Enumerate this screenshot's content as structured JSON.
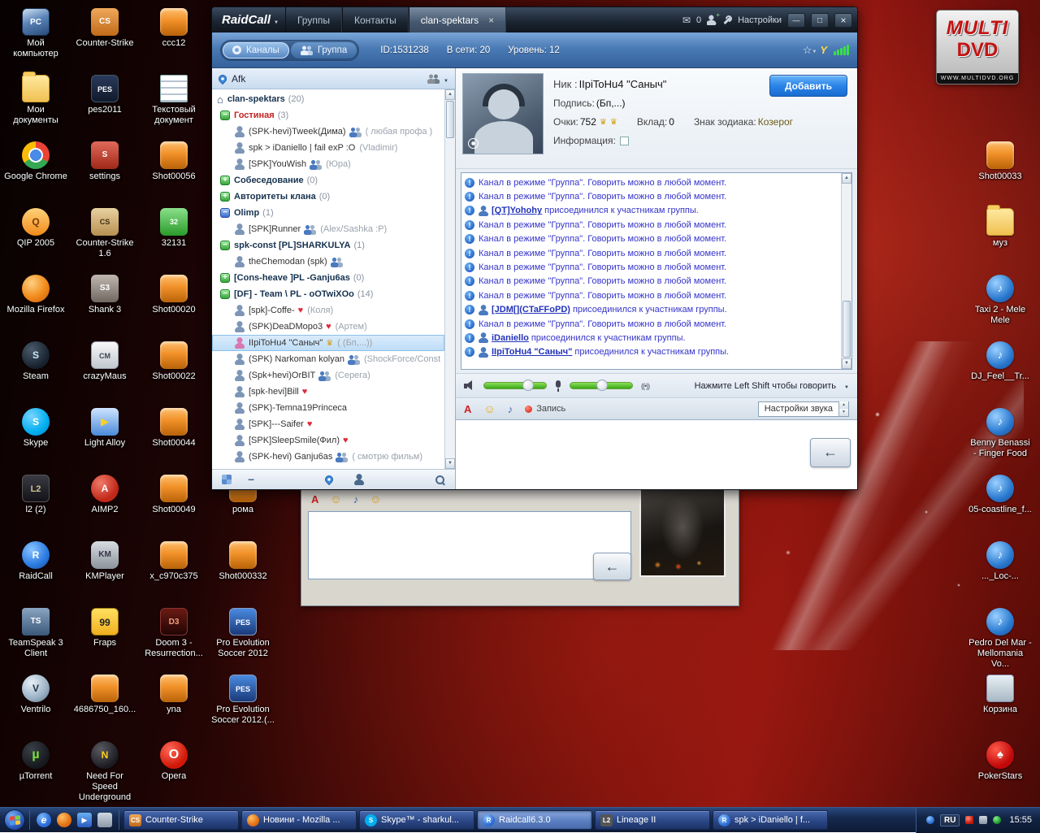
{
  "desktop": {
    "logo": {
      "line1": "MULTI",
      "line2": "DVD",
      "url": "WWW.MULTIDVD.ORG"
    },
    "left_columns": [
      [
        {
          "label": "Мой компьютер",
          "icon": "my-computer"
        },
        {
          "label": "Мои документы",
          "icon": "folder"
        },
        {
          "label": "Google Chrome",
          "icon": "chrome"
        },
        {
          "label": "QIP 2005",
          "icon": "qip"
        },
        {
          "label": "Mozilla Firefox",
          "icon": "firefox"
        },
        {
          "label": "Steam",
          "icon": "steam"
        },
        {
          "label": "Skype",
          "icon": "skype"
        },
        {
          "label": "l2 (2)",
          "icon": "lineage2"
        },
        {
          "label": "RaidCall",
          "icon": "raidcall"
        },
        {
          "label": "TeamSpeak 3 Client",
          "icon": "teamspeak"
        },
        {
          "label": "Ventrilo",
          "icon": "ventrilo"
        },
        {
          "label": "µTorrent",
          "icon": "utorrent"
        }
      ],
      [
        {
          "label": "Counter-Strike",
          "icon": "cs"
        },
        {
          "label": "pes2011",
          "icon": "pes"
        },
        {
          "label": "settings",
          "icon": "red-app"
        },
        {
          "label": "Counter-Strike 1.6",
          "icon": "cs16"
        },
        {
          "label": "Shank 3",
          "icon": "shank"
        },
        {
          "label": "crazyMaus",
          "icon": "crazymaus"
        },
        {
          "label": "Light Alloy",
          "icon": "lightalloy"
        },
        {
          "label": "AIMP2",
          "icon": "aimp"
        },
        {
          "label": "KMPlayer",
          "icon": "kmplayer"
        },
        {
          "label": "Fraps",
          "icon": "fraps"
        },
        {
          "label": "4686750_160...",
          "icon": "shot"
        },
        {
          "label": "Need For Speed Underground",
          "icon": "nfs"
        }
      ],
      [
        {
          "label": "ccc12",
          "icon": "shot"
        },
        {
          "label": "Текстовый документ",
          "icon": "textdoc"
        },
        {
          "label": "Shot00056",
          "icon": "shot"
        },
        {
          "label": "32131",
          "icon": "green"
        },
        {
          "label": "Shot00020",
          "icon": "shot"
        },
        {
          "label": "Shot00022",
          "icon": "shot"
        },
        {
          "label": "Shot00044",
          "icon": "shot"
        },
        {
          "label": "Shot00049",
          "icon": "shot"
        },
        {
          "label": "x_c970c375",
          "icon": "shot"
        },
        {
          "label": "Doom 3 - Resurrection...",
          "icon": "doom"
        },
        {
          "label": "yna",
          "icon": "shot"
        },
        {
          "label": "Opera",
          "icon": "opera"
        }
      ],
      [
        {
          "label": "рома",
          "icon": "shot",
          "row": 7
        },
        {
          "label": "Shot000332",
          "icon": "shot",
          "row": 8
        },
        {
          "label": "Pro Evolution Soccer 2012",
          "icon": "pes2012",
          "row": 9
        },
        {
          "label": "Pro Evolution Soccer 2012.(...",
          "icon": "pes2012",
          "row": 10
        }
      ]
    ],
    "right_column": [
      {
        "label": "Shot00033",
        "icon": "shot",
        "row": 2
      },
      {
        "label": "муз",
        "icon": "folder",
        "row": 3
      },
      {
        "label": "Taxi 2 - Mele Mele",
        "icon": "media",
        "row": 4
      },
      {
        "label": "DJ_Feel__Tr...",
        "icon": "media",
        "row": 5
      },
      {
        "label": "Benny Benassi - Finger Food",
        "icon": "media",
        "row": 6
      },
      {
        "label": "05-coastline_f...",
        "icon": "media",
        "row": 7
      },
      {
        "label": "..._Loc-...",
        "icon": "media",
        "row": 8
      },
      {
        "label": "Pedro Del Mar - Mellomania Vo...",
        "icon": "media",
        "row": 9
      },
      {
        "label": "Корзина",
        "icon": "recycle",
        "row": 10
      },
      {
        "label": "PokerStars",
        "icon": "pokerstars",
        "row": 11
      }
    ]
  },
  "raidcall": {
    "titlebar": {
      "app": "RaidCall",
      "mail_count": "0",
      "settings": "Настройки",
      "tabs": [
        {
          "label": "Группы"
        },
        {
          "label": "Контакты"
        },
        {
          "label": "clan-spektars",
          "active": true,
          "closable": true
        }
      ]
    },
    "infobar": {
      "channels": "Каналы",
      "group": "Группа",
      "id": "ID:1531238",
      "online": "В сети: 20",
      "level": "Уровень: 12"
    },
    "status": "Afk",
    "tree": [
      {
        "t": "home",
        "label": "clan-spektars",
        "count": "(20)"
      },
      {
        "t": "ch",
        "exp": true,
        "red": true,
        "label": "Гостиная",
        "count": "(3)"
      },
      {
        "t": "user",
        "label": "(SPK-hevi)Tweek(Дима)",
        "badges": [
          "group"
        ],
        "note": "( любая профа )"
      },
      {
        "t": "user",
        "label": "spk > iDaniello | fail exP :O",
        "note": "(Vladimir)"
      },
      {
        "t": "user",
        "label": "[SPK]YouWish",
        "badges": [
          "group"
        ],
        "note": "(Юра)"
      },
      {
        "t": "ch",
        "exp": false,
        "label": "Собеседование",
        "count": "(0)"
      },
      {
        "t": "ch",
        "exp": false,
        "label": "Авторитеты клана",
        "count": "(0)"
      },
      {
        "t": "ch",
        "exp": true,
        "blue": true,
        "label": "Olimp",
        "count": "(1)"
      },
      {
        "t": "user",
        "label": "[SPK]Runner",
        "badges": [
          "group"
        ],
        "note": "(Alex/Sashka :P)"
      },
      {
        "t": "ch",
        "exp": true,
        "label": "spk-const [PL]SHARKULYA",
        "count": "(1)"
      },
      {
        "t": "user",
        "label": "theChemodan (spk)",
        "badges": [
          "group"
        ]
      },
      {
        "t": "ch",
        "exp": false,
        "label": "[Cons-heave ]PL -Ganju6as",
        "count": "(0)"
      },
      {
        "t": "ch",
        "exp": true,
        "label": "[DF] - Team \\ PL - oOTwiXOo",
        "count": "(14)"
      },
      {
        "t": "user",
        "label": "[spk]-Coffe-",
        "badges": [
          "heart"
        ],
        "note": "(Коля)"
      },
      {
        "t": "user",
        "label": "(SPK)DeaDMopo3",
        "badges": [
          "heart"
        ],
        "note": "(Артем)"
      },
      {
        "t": "user",
        "sel": true,
        "label": "IIpiToHu4 \"Саныч\"",
        "badges": [
          "crown"
        ],
        "note": "( (Бп,...))"
      },
      {
        "t": "user",
        "label": "(SPK) Narkoman kolyan",
        "badges": [
          "group"
        ],
        "note": "(ShockForce/Const"
      },
      {
        "t": "user",
        "label": "(Spk+hevi)OrBIT",
        "badges": [
          "group"
        ],
        "note": "(Серега)"
      },
      {
        "t": "user",
        "label": "[spk-hevi]Bill",
        "badges": [
          "heart"
        ]
      },
      {
        "t": "user",
        "label": "(SPK)-Temna19Princeca"
      },
      {
        "t": "user",
        "label": "[SPK]---Saifer",
        "badges": [
          "heart"
        ]
      },
      {
        "t": "user",
        "label": "[SPK]SleepSmile(Фил)",
        "badges": [
          "heart"
        ]
      },
      {
        "t": "user",
        "label": "(SPK-hevi) Ganju6as",
        "badges": [
          "group"
        ],
        "note": "( смотрю фильм)"
      }
    ],
    "profile": {
      "nick_label": "Ник :",
      "nick": "IIpiToHu4 \"Саныч\"",
      "add_button": "Добавить",
      "sign_label": "Подпись:",
      "sign": "(Бп,...)",
      "points_label": "Очки:",
      "points": "752",
      "vklad_label": "Вклад:",
      "vklad": "0",
      "zodiac_label": "Знак зодиака:",
      "zodiac": "Козерог",
      "info_label": "Информация:"
    },
    "chat": [
      {
        "kind": "info",
        "text": "Канал в режиме \"Группа\". Говорить можно в любой момент."
      },
      {
        "kind": "info",
        "text": "Канал в режиме \"Группа\". Говорить можно в любой момент."
      },
      {
        "kind": "join",
        "name": "[QT]Yohohy",
        "text": "присоединился к участникам группы."
      },
      {
        "kind": "info",
        "text": "Канал в режиме \"Группа\". Говорить можно в любой момент."
      },
      {
        "kind": "info",
        "text": "Канал в режиме \"Группа\". Говорить можно в любой момент."
      },
      {
        "kind": "info",
        "text": "Канал в режиме \"Группа\". Говорить можно в любой момент."
      },
      {
        "kind": "info",
        "text": "Канал в режиме \"Группа\". Говорить можно в любой момент."
      },
      {
        "kind": "info",
        "text": "Канал в режиме \"Группа\". Говорить можно в любой момент."
      },
      {
        "kind": "info",
        "text": "Канал в режиме \"Группа\". Говорить можно в любой момент."
      },
      {
        "kind": "join",
        "name": "[JDM[](CTaFFoPD)",
        "text": "присоединился к участникам группы."
      },
      {
        "kind": "info",
        "text": "Канал в режиме \"Группа\". Говорить можно в любой момент."
      },
      {
        "kind": "join",
        "name": "iDaniello",
        "text": "присоединился к участникам группы."
      },
      {
        "kind": "join",
        "name": "IIpiToHu4 \"Саныч\"",
        "text": "присоединился к участникам группы."
      }
    ],
    "voice": {
      "ptt": "Нажмите Left Shift чтобы говорить",
      "record": "Запись",
      "sound_settings": "Настройки звука"
    }
  },
  "taskbar": {
    "quicklaunch": [
      {
        "icon": "internet-explorer"
      },
      {
        "icon": "firefox"
      },
      {
        "icon": "media-player"
      },
      {
        "icon": "show-desktop"
      }
    ],
    "tasks": [
      {
        "label": "Counter-Strike",
        "icon": "cs"
      },
      {
        "label": "Новини - Mozilla ...",
        "icon": "firefox"
      },
      {
        "label": "Skype™ - sharkul...",
        "icon": "skype"
      },
      {
        "label": "Raidcall6.3.0",
        "icon": "raidcall",
        "active": true
      },
      {
        "label": "Lineage II",
        "icon": "lineage"
      },
      {
        "label": "spk > iDaniello | f...",
        "icon": "raidcall"
      }
    ],
    "tray": {
      "lang": "RU",
      "time": "15:55"
    }
  }
}
